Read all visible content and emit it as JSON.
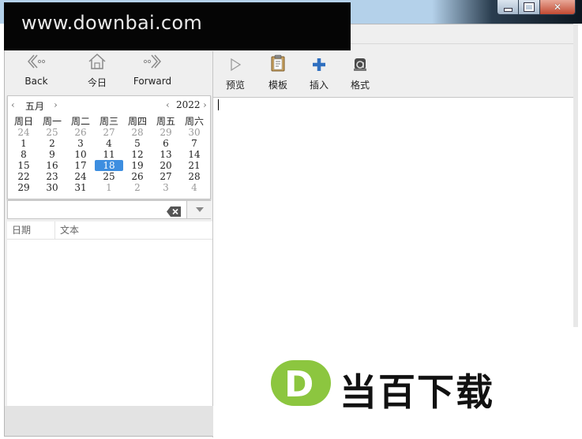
{
  "watermark": {
    "site": "www.downbai.com",
    "logo_letter": "D",
    "logo_text": "当百下载"
  },
  "window": {
    "close_glyph": "✕"
  },
  "left_toolbar": {
    "back_label": "Back",
    "today_label": "今日",
    "forward_label": "Forward"
  },
  "right_toolbar": {
    "preview_label": "预览",
    "template_label": "模板",
    "insert_label": "插入",
    "format_label": "格式"
  },
  "calendar": {
    "month": "五月",
    "year": "2022",
    "prev": "‹",
    "next": "›",
    "weekdays": [
      "周日",
      "周一",
      "周二",
      "周三",
      "周四",
      "周五",
      "周六"
    ],
    "weeks": [
      [
        "24",
        "25",
        "26",
        "27",
        "28",
        "29",
        "30"
      ],
      [
        "1",
        "2",
        "3",
        "4",
        "5",
        "6",
        "7"
      ],
      [
        "8",
        "9",
        "10",
        "11",
        "12",
        "13",
        "14"
      ],
      [
        "15",
        "16",
        "17",
        "18",
        "19",
        "20",
        "21"
      ],
      [
        "22",
        "23",
        "24",
        "25",
        "26",
        "27",
        "28"
      ],
      [
        "29",
        "30",
        "31",
        "1",
        "2",
        "3",
        "4"
      ]
    ],
    "selected_day": "18"
  },
  "search": {
    "value": "",
    "placeholder": ""
  },
  "list": {
    "columns": [
      "日期",
      "文本"
    ]
  },
  "colors": {
    "selection": "#3d8ee0",
    "logo_green": "#8cc63f"
  }
}
